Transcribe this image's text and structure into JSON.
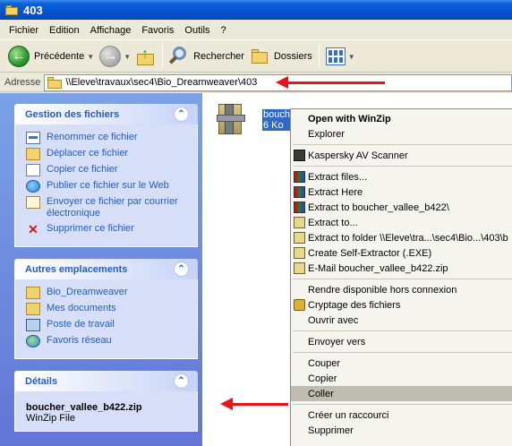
{
  "window": {
    "title": "403"
  },
  "menu": [
    "Fichier",
    "Edition",
    "Affichage",
    "Favoris",
    "Outils",
    "?"
  ],
  "toolbar": {
    "back_label": "Précédente",
    "search_label": "Rechercher",
    "folders_label": "Dossiers"
  },
  "address": {
    "label": "Adresse",
    "value": "\\\\Eleve\\travaux\\sec4\\Bio_Dreamweaver\\403"
  },
  "taskpane": {
    "file_tasks": {
      "title": "Gestion des fichiers",
      "items": [
        "Renommer ce fichier",
        "Déplacer ce fichier",
        "Copier ce fichier",
        "Publier ce fichier sur le Web",
        "Envoyer ce fichier par courrier électronique",
        "Supprimer ce fichier"
      ]
    },
    "other_places": {
      "title": "Autres emplacements",
      "items": [
        "Bio_Dreamweaver",
        "Mes documents",
        "Poste de travail",
        "Favoris réseau"
      ]
    },
    "details": {
      "title": "Détails",
      "file_name": "boucher_vallee_b422.zip",
      "file_type": "WinZip File"
    }
  },
  "file": {
    "name": "bouche",
    "size": "6 Ko"
  },
  "context_menu": {
    "items": [
      "Open with WinZip",
      "Explorer",
      "Kaspersky AV Scanner",
      "Extract files...",
      "Extract Here",
      "Extract to boucher_vallee_b422\\",
      "Extract to...",
      "Extract to folder \\\\Eleve\\tra...\\sec4\\Bio...\\403\\b",
      "Create Self-Extractor (.EXE)",
      "E-Mail boucher_vallee_b422.zip",
      "Rendre disponible hors connexion",
      "Cryptage des fichiers",
      "Ouvrir avec",
      "Envoyer vers",
      "Couper",
      "Copier",
      "Coller",
      "Créer un raccourci",
      "Supprimer"
    ]
  },
  "colors": {
    "annotation_arrow": "#e8141a",
    "highlight": "#bfbdb0",
    "title_bar": "#0553d0"
  }
}
